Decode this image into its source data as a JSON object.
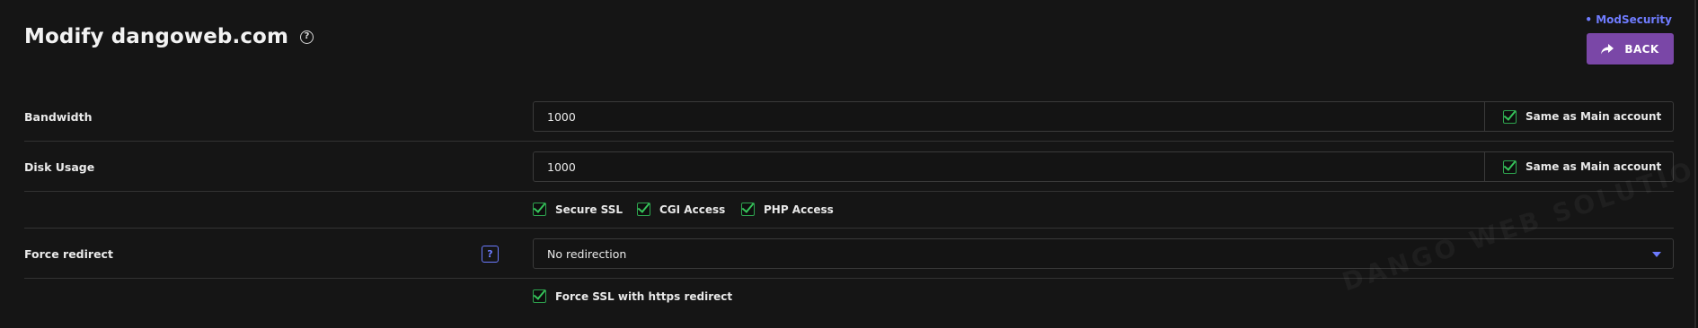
{
  "header": {
    "title": "Modify dangoweb.com",
    "help_icon": "?",
    "modsecurity_link": "• ModSecurity",
    "back_label": "BACK"
  },
  "form": {
    "bandwidth": {
      "label": "Bandwidth",
      "value": "1000",
      "same_as_label": "Same as Main account",
      "same_as_checked": true
    },
    "disk_usage": {
      "label": "Disk Usage",
      "value": "1000",
      "same_as_label": "Same as Main account",
      "same_as_checked": true
    },
    "options": [
      {
        "label": "Secure SSL",
        "checked": true
      },
      {
        "label": "CGI Access",
        "checked": true
      },
      {
        "label": "PHP Access",
        "checked": true
      }
    ],
    "force_redirect": {
      "label": "Force redirect",
      "help_icon": "?",
      "selected": "No redirection"
    },
    "force_ssl": {
      "label": "Force SSL with https redirect",
      "checked": true
    }
  },
  "watermark": "DANGO WEB SOLUTIO",
  "colors": {
    "background": "#151515",
    "accent_purple": "#7a47a7",
    "accent_blue": "#6c7bff",
    "checkbox_green": "#36c45a"
  }
}
